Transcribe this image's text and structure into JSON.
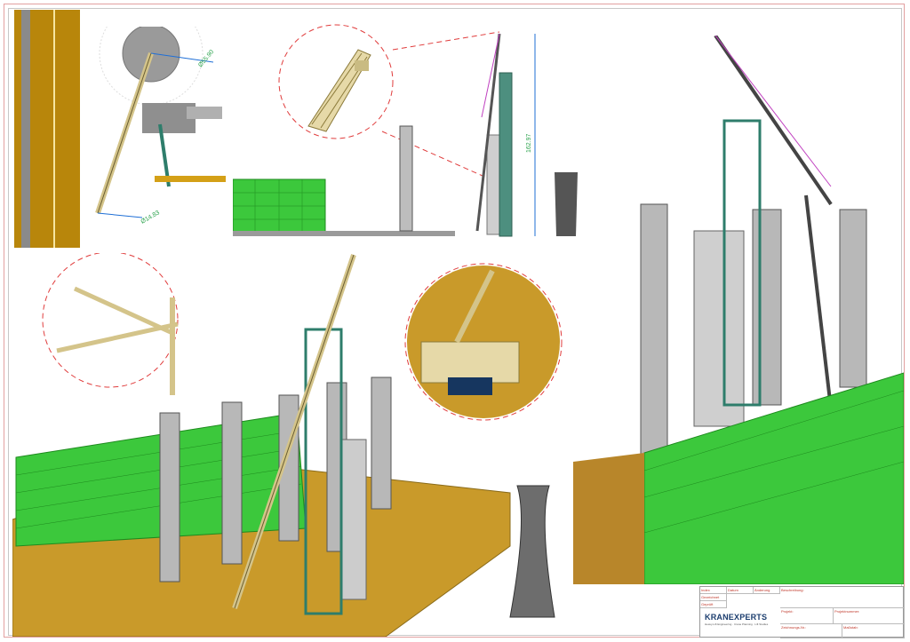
{
  "dimensions": {
    "radius_top": "Ø55.90",
    "radius_bottom": "Ø14.83",
    "height": "162.97"
  },
  "title_block": {
    "company": "KRANEXPERTS",
    "tagline": "Heavy-Lift Engineering · Crane Planning · Lift Studies",
    "labels": [
      "Index",
      "Datum",
      "Änderung",
      "Gezeichnet",
      "Geprüft",
      "Beschreibung:",
      "Projekt:",
      "Projektnummer:",
      "Zeichnungs-Nr.:",
      "Maßstab:"
    ]
  },
  "colors": {
    "structure_green": "#3cc83c",
    "ground_ochre": "#b8860b",
    "crane_cream": "#e6d9a8",
    "steel_grey": "#a9a9a9",
    "teal_frame": "#2e7d6b",
    "callout_red": "#e03c3c",
    "dimension_green": "#2ea44f"
  }
}
